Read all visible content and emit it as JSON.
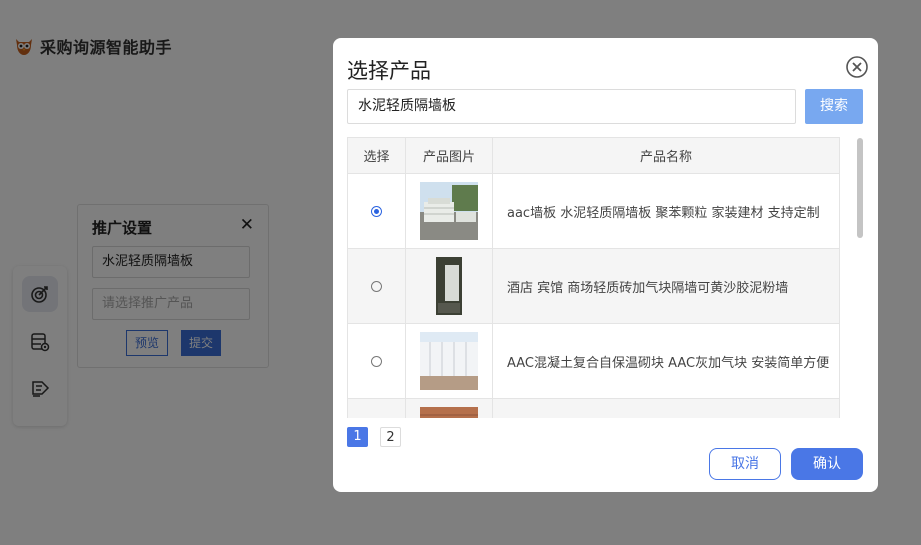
{
  "app": {
    "title": "采购询源智能助手"
  },
  "promo_panel": {
    "title": "推广设置",
    "close_glyph": "✕",
    "keyword_value": "水泥轻质隔墙板",
    "product_placeholder": "请选择推广产品",
    "preview_label": "预览",
    "submit_label": "提交"
  },
  "modal": {
    "title": "选择产品",
    "search_value": "水泥轻质隔墙板",
    "search_button": "搜索",
    "columns": {
      "select": "选择",
      "image": "产品图片",
      "name": "产品名称"
    },
    "rows": [
      {
        "name": "aac墙板 水泥轻质隔墙板 聚苯颗粒 家装建材 支持定制",
        "selected": true
      },
      {
        "name": "酒店 宾馆 商场轻质砖加气块隔墙可黄沙胶泥粉墙",
        "selected": false
      },
      {
        "name": "AAC混凝土复合自保温砌块 AAC灰加气块 安装简单方便",
        "selected": false
      },
      {
        "name": "",
        "selected": false
      }
    ],
    "pages": [
      "1",
      "2"
    ],
    "current_page": "1",
    "cancel_label": "取消",
    "confirm_label": "确认"
  },
  "colors": {
    "primary": "#4a77e6",
    "search_button": "#78a8f0",
    "overlay": "rgba(0,0,0,0.5)"
  }
}
